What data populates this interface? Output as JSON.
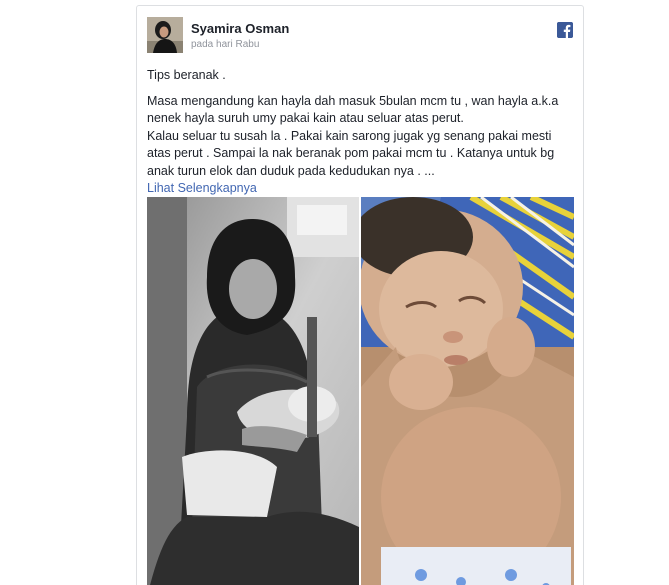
{
  "post": {
    "author": "Syamira Osman",
    "time": "pada hari Rabu",
    "brand_icon": "facebook-icon",
    "paragraphs": [
      "Tips beranak .",
      "Masa mengandung kan hayla dah masuk 5bulan mcm tu , wan hayla a.k.a nenek hayla suruh umy pakai kain atau seluar atas perut.",
      "Kalau seluar tu susah la . Pakai kain sarong jugak yg senang pakai mesti atas perut . Sampai la nak beranak pom pakai mcm tu . Katanya untuk bg anak turun elok dan duduk pada kedudukan nya . ..."
    ],
    "see_more": "Lihat Selengkapnya"
  },
  "colors": {
    "link": "#4267b2",
    "facebook_blue": "#3b5998",
    "text": "#1d2129",
    "muted": "#90949c"
  }
}
